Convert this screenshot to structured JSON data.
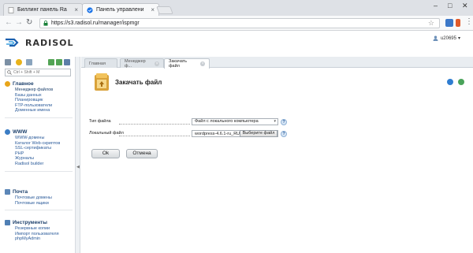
{
  "browser": {
    "tabs": [
      {
        "title": "Биллинг панель Ra",
        "close": "×"
      },
      {
        "title": "Панель управлени",
        "close": "×"
      }
    ],
    "address": "https://s3.radisol.ru/manager/ispmgr",
    "window_controls": {
      "minimize": "–",
      "maximize": "□",
      "close": "✕"
    }
  },
  "header": {
    "brand": "RADISOL",
    "user": "u20695",
    "user_caret": "▾"
  },
  "sidebar": {
    "search_placeholder": "Ctrl + Shift + M",
    "groups": [
      {
        "title": "Главное",
        "icon": "home-icon",
        "items": [
          "Менеджер файлов",
          "Базы данных",
          "Планировщик",
          "FTP-пользователи",
          "Доменные имена"
        ]
      },
      {
        "title": "WWW",
        "icon": "globe-icon",
        "items": [
          "WWW-домены",
          "Каталог Web-скриптов",
          "SSL-сертификаты",
          "PHP",
          "Журналы",
          "Radisol builder"
        ]
      },
      {
        "title": "Почта",
        "icon": "mail-icon",
        "items": [
          "Почтовые домены",
          "Почтовые ящики"
        ]
      },
      {
        "title": "Инструменты",
        "icon": "tools-icon",
        "items": [
          "Резервные копии",
          "Импорт пользователя",
          "phpMyAdmin"
        ]
      }
    ]
  },
  "main": {
    "tabs": [
      {
        "label": "Главная"
      },
      {
        "label": "Менеджер ф..."
      },
      {
        "label": "Закачать файл"
      }
    ],
    "form_title": "Закачать файл",
    "fields": {
      "file_type_label": "Тип файла",
      "file_type_value": "Файл с локального компьютера",
      "local_file_label": "Локальный файл",
      "local_file_value": "wordpress-4.6.1-ru_RU.",
      "browse_label": "Выберите файл",
      "help": "?"
    },
    "buttons": {
      "ok": "Ok",
      "cancel": "Отмена"
    }
  },
  "colors": {
    "accent": "#2b5b9a",
    "heading": "#1b3f6b",
    "logo_blue": "#1a5fae"
  }
}
